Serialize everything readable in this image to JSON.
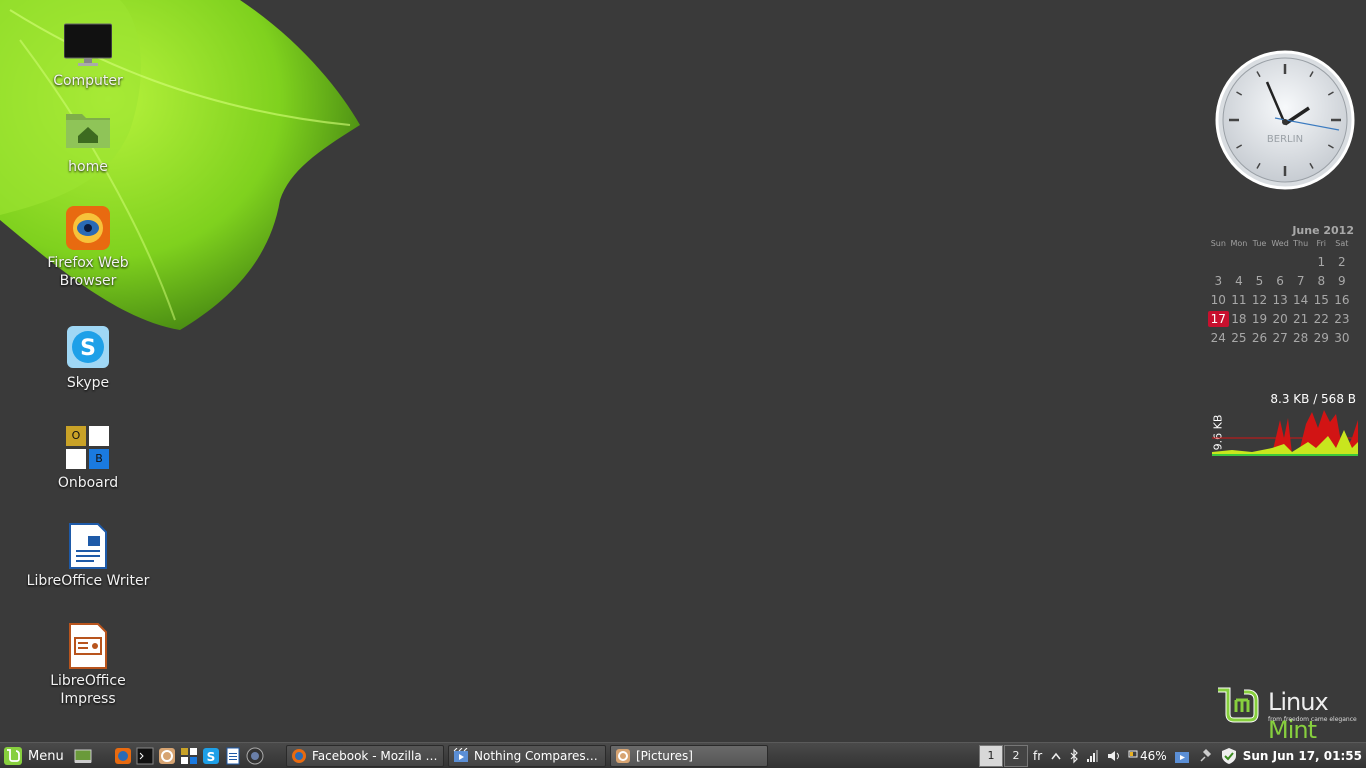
{
  "desktop": {
    "icons": [
      {
        "label": "Computer"
      },
      {
        "label": "home"
      },
      {
        "label": "Firefox Web Browser"
      },
      {
        "label": "Skype"
      },
      {
        "label": "Onboard"
      },
      {
        "label": "LibreOffice Writer"
      },
      {
        "label": "LibreOffice Impress"
      }
    ],
    "onboard_keys": [
      "O",
      "B"
    ]
  },
  "clock": {
    "city": "BERLIN"
  },
  "calendar": {
    "month": "June 2012",
    "weekdays": [
      "Sun",
      "Mon",
      "Tue",
      "Wed",
      "Thu",
      "Fri",
      "Sat"
    ],
    "days": [
      "",
      "",
      "",
      "",
      "",
      "1",
      "2",
      "3",
      "4",
      "5",
      "6",
      "7",
      "8",
      "9",
      "10",
      "11",
      "12",
      "13",
      "14",
      "15",
      "16",
      "17",
      "18",
      "19",
      "20",
      "21",
      "22",
      "23",
      "24",
      "25",
      "26",
      "27",
      "28",
      "29",
      "30"
    ],
    "today": "17",
    "today_color": "#c8102e"
  },
  "netspeed": {
    "rate": "8.3 KB / 568 B",
    "axis_label": "9.6 KB",
    "colors": {
      "download": "#d21414",
      "upload": "#c8e61e",
      "total": "#3cc83c"
    }
  },
  "logo": {
    "word_linux": "Linux",
    "word_mint": "Mint",
    "tagline": "from freedom came elegance",
    "brand_color": "#87cf3e"
  },
  "panel": {
    "menu_label": "Menu",
    "launchers": [
      "show-desktop-icon",
      "firefox-icon",
      "terminal-icon",
      "nemo-icon",
      "onboard-icon",
      "skype-icon",
      "writer-icon",
      "screenshot-icon"
    ],
    "tasks": [
      {
        "label": "Facebook - Mozilla F...",
        "icon": "firefox-icon"
      },
      {
        "label": "Nothing Compares 2...",
        "icon": "video-icon"
      },
      {
        "label": "[Pictures]",
        "icon": "folder-icon"
      }
    ],
    "workspaces": [
      "1",
      "2"
    ],
    "keyboard_layout": "fr",
    "battery": "46%",
    "datetime": "Sun Jun 17, 01:55"
  }
}
